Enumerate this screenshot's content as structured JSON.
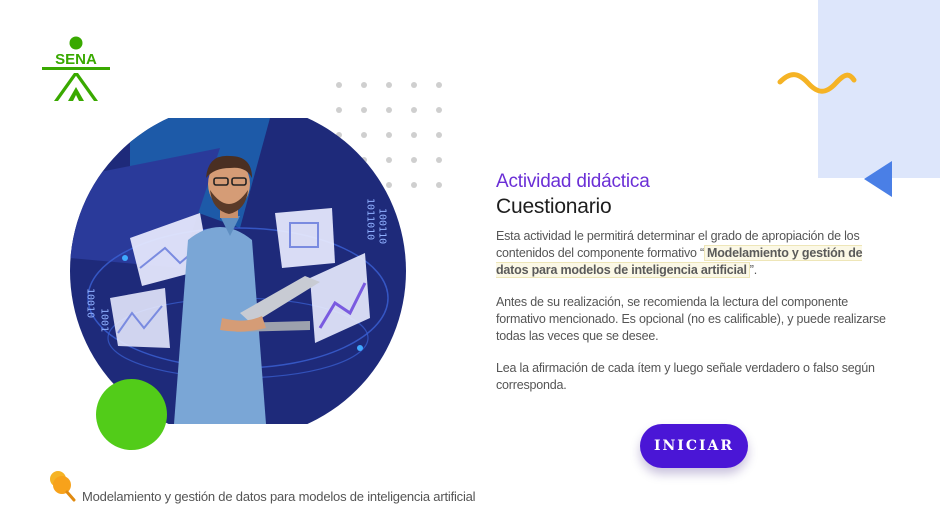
{
  "logo": {
    "text": "SENA",
    "color": "#39a900"
  },
  "activity": {
    "type_label": "Actividad didáctica",
    "title": "Cuestionario",
    "intro_before": "Esta actividad le permitirá determinar el grado de apropiación de los contenidos del componente formativo “",
    "intro_highlight": "Modelamiento y gestión de datos para modelos de inteligencia artificial",
    "intro_after": "”.",
    "note": "Antes de su realización, se recomienda la lectura del componente formativo mencionado.  Es opcional (no es calificable), y puede realizarse todas las veces que se desee.",
    "instruction": "Lea la afirmación de cada ítem y luego señale verdadero o falso según corresponda."
  },
  "start_button": {
    "label": "INICIAR"
  },
  "footer": {
    "text": "Modelamiento y gestión de datos para modelos de inteligencia artificial",
    "icon": "pin-icon"
  },
  "colors": {
    "accent_purple": "#6b2fd6",
    "button": "#4a16d6",
    "green": "#52cc19",
    "wave": "#f5b325",
    "triangle": "#4a7fe6",
    "panel": "#dde6fb"
  }
}
